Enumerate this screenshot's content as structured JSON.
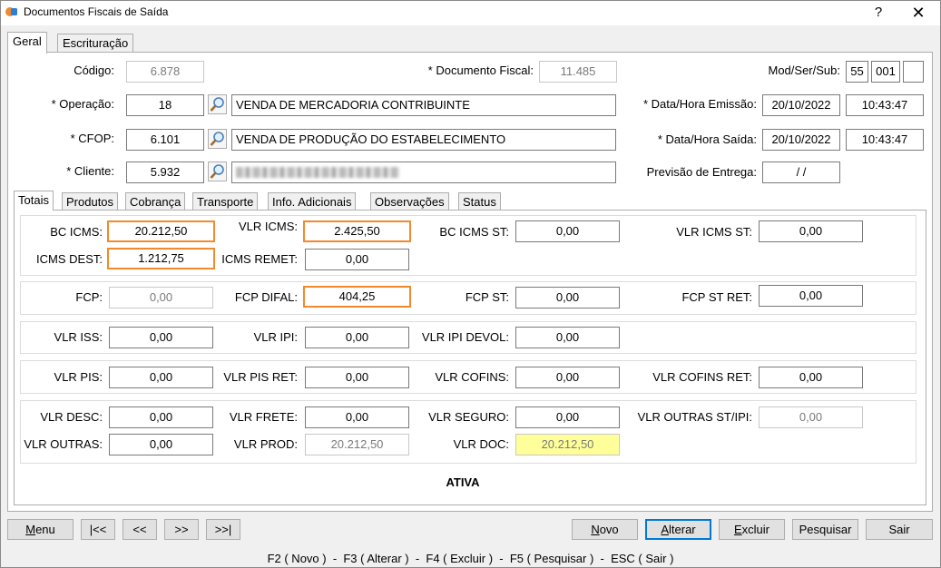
{
  "window": {
    "title": "Documentos Fiscais de Saída",
    "help_label": "?",
    "close_label": "✕",
    "app_icon": "orange-blue-app-icon"
  },
  "tabs": [
    "Geral",
    "Escrituração"
  ],
  "header": {
    "codigo_label": "Código:",
    "codigo": "6.878",
    "documento_fiscal_label": "* Documento Fiscal:",
    "documento_fiscal": "11.485",
    "mod_ser_sub_label": "Mod/Ser/Sub:",
    "mod": "55",
    "ser": "001",
    "sub": "",
    "operacao_label": "* Operação:",
    "operacao_code": "18",
    "operacao_desc": "VENDA DE MERCADORIA CONTRIBUINTE",
    "data_emissao_label": "* Data/Hora Emissão:",
    "data_emissao": "20/10/2022",
    "hora_emissao": "10:43:47",
    "cfop_label": "* CFOP:",
    "cfop_code": "6.101",
    "cfop_desc": "VENDA DE PRODUÇÃO DO ESTABELECIMENTO",
    "data_saida_label": "* Data/Hora Saída:",
    "data_saida": "20/10/2022",
    "hora_saida": "10:43:47",
    "cliente_label": "* Cliente:",
    "cliente_code": "5.932",
    "previsao_label": "Previsão de Entrega:",
    "previsao": "/ /"
  },
  "subtabs": [
    "Totais",
    "Produtos",
    "Cobrança",
    "Transporte",
    "Info. Adicionais",
    "Observações",
    "Status"
  ],
  "totais": {
    "bc_icms_label": "BC ICMS:",
    "bc_icms": "20.212,50",
    "vlr_icms_label": "VLR ICMS:",
    "vlr_icms": "2.425,50",
    "bc_icms_st_label": "BC ICMS ST:",
    "bc_icms_st": "0,00",
    "vlr_icms_st_label": "VLR ICMS ST:",
    "vlr_icms_st": "0,00",
    "icms_dest_label": "ICMS DEST:",
    "icms_dest": "1.212,75",
    "icms_remet_label": "ICMS REMET:",
    "icms_remet": "0,00",
    "fcp_label": "FCP:",
    "fcp": "0,00",
    "fcp_difal_label": "FCP DIFAL:",
    "fcp_difal": "404,25",
    "fcp_st_label": "FCP ST:",
    "fcp_st": "0,00",
    "fcp_st_ret_label": "FCP ST RET:",
    "fcp_st_ret": "0,00",
    "vlr_iss_label": "VLR ISS:",
    "vlr_iss": "0,00",
    "vlr_ipi_label": "VLR IPI:",
    "vlr_ipi": "0,00",
    "vlr_ipi_devol_label": "VLR IPI DEVOL:",
    "vlr_ipi_devol": "0,00",
    "vlr_pis_label": "VLR PIS:",
    "vlr_pis": "0,00",
    "vlr_pis_ret_label": "VLR PIS RET:",
    "vlr_pis_ret": "0,00",
    "vlr_cofins_label": "VLR COFINS:",
    "vlr_cofins": "0,00",
    "vlr_cofins_ret_label": "VLR COFINS RET:",
    "vlr_cofins_ret": "0,00",
    "vlr_desc_label": "VLR DESC:",
    "vlr_desc": "0,00",
    "vlr_frete_label": "VLR FRETE:",
    "vlr_frete": "0,00",
    "vlr_seguro_label": "VLR SEGURO:",
    "vlr_seguro": "0,00",
    "vlr_outras_st_ipi_label": "VLR OUTRAS ST/IPI:",
    "vlr_outras_st_ipi": "0,00",
    "vlr_outras_label": "VLR OUTRAS:",
    "vlr_outras": "0,00",
    "vlr_prod_label": "VLR PROD:",
    "vlr_prod": "20.212,50",
    "vlr_doc_label": "VLR DOC:",
    "vlr_doc": "20.212,50"
  },
  "status": "ATIVA",
  "nav": {
    "menu": {
      "u": "M",
      "rest": "enu"
    },
    "first": "|<<",
    "prev": "<<",
    "next": ">>",
    "last": ">>|"
  },
  "actions": {
    "novo": {
      "u": "N",
      "rest": "ovo"
    },
    "alterar": {
      "u": "A",
      "rest": "lterar"
    },
    "excluir": {
      "u": "E",
      "rest": "xcluir"
    },
    "pesquisar": "Pesquisar",
    "sair": "Sair"
  },
  "shortcuts": "F2 ( Novo )  -  F3 ( Alterar )  -  F4 ( Excluir )  -  F5 ( Pesquisar )  -  ESC ( Sair )",
  "colors": {
    "highlight": "#f08a2c",
    "doc_total_bg": "#ffff9a",
    "focus": "#0078d7"
  }
}
